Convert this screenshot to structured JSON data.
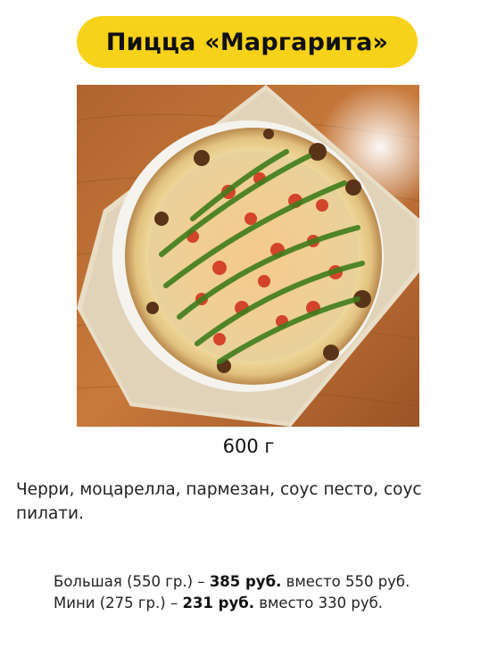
{
  "title": "Пицца «Маргарита»",
  "image_alt": "pizza-photo",
  "weight": "600 г",
  "description": "Черри, моцарелла, пармезан, соус песто, соус пилати.",
  "sizes": [
    {
      "label": "Большая (550 гр.) – ",
      "price": "385 руб.",
      "old": " вместо 550 руб."
    },
    {
      "label": "Мини (275 гр.) – ",
      "price": "231 руб.",
      "old": " вместо 330 руб."
    }
  ],
  "colors": {
    "accent": "#f7d21a",
    "text": "#111111"
  }
}
